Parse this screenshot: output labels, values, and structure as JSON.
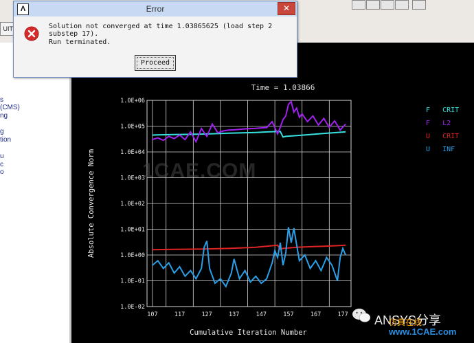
{
  "toolbar": {
    "quit_label": "UIT"
  },
  "left_panel": {
    "fragments": [
      "s",
      "(CMS)",
      "ng",
      "g",
      "tion",
      "u",
      "c",
      "o"
    ]
  },
  "dialog": {
    "title": "Error",
    "app_icon": "Λ",
    "close_glyph": "✕",
    "message_lines": [
      "Solution not converged at time 1.03865625 (load step 2",
      "substep 17).",
      "Run terminated."
    ],
    "proceed_label": "Proceed",
    "icon": "error-icon"
  },
  "chart_data": {
    "type": "line",
    "title": "Time = 1.03866",
    "xlabel": "Cumulative Iteration Number",
    "ylabel": "Absolute Convergence Norm",
    "yscale": "log",
    "xlim": [
      105,
      180
    ],
    "ylim": [
      0.01,
      1000000
    ],
    "x_ticks": [
      "107",
      "117",
      "127",
      "137",
      "147",
      "157",
      "167",
      "177"
    ],
    "y_ticks": [
      "1.0E-02",
      "1.0E-01",
      "1.0E+00",
      "1.0E+01",
      "1.0E+02",
      "1.0E+03",
      "1.0E+04",
      "1.0E+05",
      "1.0E+06"
    ],
    "grid": true,
    "background": "#000000",
    "legend_position": "right",
    "series": [
      {
        "name": "F   CRIT",
        "color": "#35e2e0",
        "x": [
          107,
          110,
          115,
          120,
          125,
          130,
          135,
          140,
          145,
          150,
          154,
          155,
          156,
          160,
          165,
          170,
          175,
          178
        ],
        "y": [
          45000,
          46000,
          47000,
          48000,
          49000,
          51000,
          53000,
          55000,
          57000,
          60000,
          62000,
          38000,
          40000,
          43000,
          47000,
          52000,
          57000,
          60000
        ]
      },
      {
        "name": "F   L2",
        "color": "#a020f0",
        "x": [
          107,
          109,
          111,
          113,
          115,
          117,
          119,
          121,
          123,
          125,
          127,
          129,
          131,
          133,
          135,
          137,
          139,
          141,
          143,
          145,
          147,
          149,
          151,
          153,
          154,
          155,
          156,
          157,
          158,
          159,
          160,
          161,
          162,
          164,
          166,
          168,
          170,
          172,
          174,
          176,
          178
        ],
        "y": [
          30000,
          35000,
          28000,
          40000,
          33000,
          45000,
          30000,
          60000,
          25000,
          80000,
          40000,
          120000,
          55000,
          65000,
          70000,
          72000,
          75000,
          78000,
          80000,
          82000,
          85000,
          88000,
          150000,
          50000,
          90000,
          180000,
          250000,
          700000,
          900000,
          350000,
          500000,
          220000,
          300000,
          150000,
          250000,
          110000,
          200000,
          90000,
          160000,
          70000,
          120000
        ]
      },
      {
        "name": "U   CRIT",
        "color": "#e02424",
        "x": [
          107,
          115,
          125,
          135,
          145,
          153,
          154,
          155,
          160,
          165,
          170,
          175,
          178
        ],
        "y": [
          1.6,
          1.65,
          1.7,
          1.8,
          2.0,
          2.4,
          1.7,
          1.8,
          2.0,
          2.1,
          2.2,
          2.3,
          2.4
        ]
      },
      {
        "name": "U   INF",
        "color": "#2a9fe8",
        "x": [
          107,
          109,
          111,
          113,
          115,
          117,
          119,
          121,
          123,
          125,
          126,
          127,
          128,
          130,
          132,
          134,
          136,
          137,
          139,
          141,
          143,
          145,
          147,
          149,
          151,
          152,
          153,
          154,
          155,
          156,
          157,
          158,
          159,
          160,
          161,
          163,
          165,
          167,
          169,
          171,
          173,
          175,
          176,
          177,
          178
        ],
        "y": [
          0.4,
          0.6,
          0.3,
          0.5,
          0.2,
          0.35,
          0.15,
          0.25,
          0.12,
          0.3,
          2.0,
          3.5,
          0.3,
          0.08,
          0.12,
          0.06,
          0.2,
          0.7,
          0.12,
          0.25,
          0.09,
          0.15,
          0.08,
          0.12,
          0.5,
          1.5,
          0.8,
          3.0,
          0.4,
          1.2,
          12,
          3,
          11,
          2.5,
          0.6,
          1.0,
          0.3,
          0.6,
          0.25,
          0.8,
          0.4,
          0.1,
          0.8,
          1.8,
          1.0
        ]
      }
    ]
  },
  "watermarks": {
    "center": "1CAE.COM",
    "brand": "ANSYS分享",
    "sim": "仿真在线",
    "site": "www.1CAE.com"
  }
}
